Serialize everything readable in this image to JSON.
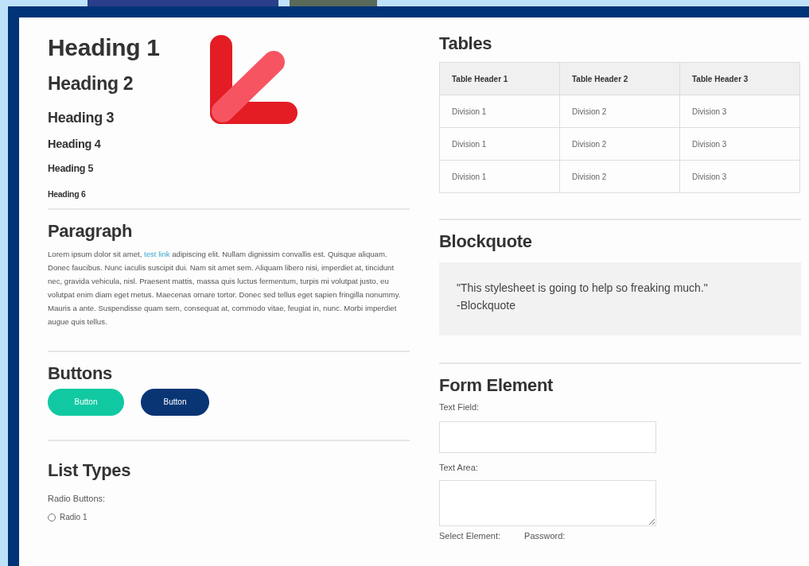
{
  "headings": [
    "Heading 1",
    "Heading 2",
    "Heading 3",
    "Heading 4",
    "Heading 5",
    "Heading 6"
  ],
  "paragraph": {
    "title": "Paragraph",
    "before": "Lorem ipsum dolor sit amet,",
    "link": "test link",
    "after": "adipiscing elit. Nullam dignissim convallis est. Quisque aliquam. Donec faucibus. Nunc iaculis suscipit dui. Nam sit amet sem. Aliquam libero nisi, imperdiet at, tincidunt nec, gravida vehicula, nisl. Praesent mattis, massa quis luctus fermentum, turpis mi volutpat justo, eu volutpat enim diam eget metus. Maecenas ornare tortor. Donec sed tellus eget sapien fringilla nonummy. Mauris a ante. Suspendisse quam sem, consequat at, commodo vitae, feugiat in, nunc. Morbi imperdiet augue quis tellus."
  },
  "buttons": {
    "title": "Buttons",
    "items": [
      {
        "label": "Button",
        "color": "#10c9a2"
      },
      {
        "label": "Button",
        "color": "#0a3575"
      }
    ]
  },
  "lists": {
    "title": "List Types",
    "radio_label": "Radio Buttons:",
    "radios": [
      {
        "label": "Radio 1",
        "selected": false
      }
    ]
  },
  "tables": {
    "title": "Tables",
    "columns": [
      "Table Header 1",
      "Table Header 2",
      "Table Header 3"
    ],
    "rows": [
      [
        "Division 1",
        "Division 2",
        "Division 3"
      ],
      [
        "Division 1",
        "Division 2",
        "Division 3"
      ],
      [
        "Division 1",
        "Division 2",
        "Division 3"
      ]
    ]
  },
  "blockquote": {
    "title": "Blockquote",
    "quote": "\"This stylesheet is going to help so freaking much.\"",
    "cite": "-Blockquote"
  },
  "form": {
    "title": "Form Element",
    "text_field_label": "Text Field:",
    "text_area_label": "Text Area:",
    "select_label": "Select Element:",
    "password_label": "Password:"
  }
}
